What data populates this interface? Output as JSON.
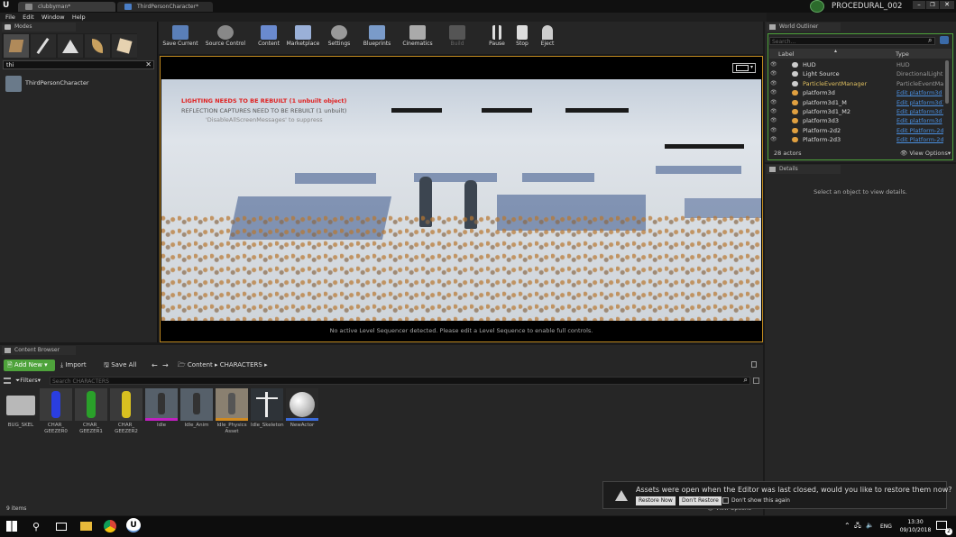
{
  "window": {
    "tabs": [
      "clubbyman*",
      "ThirdPersonCharacter*"
    ],
    "project": "PROCEDURAL_002"
  },
  "menu": [
    "File",
    "Edit",
    "Window",
    "Help"
  ],
  "modes": {
    "panel_title": "Modes",
    "search_value": "thi",
    "result": "ThirdPersonCharacter"
  },
  "toolbar": {
    "buttons": [
      "Save Current",
      "Source Control",
      "Content",
      "Marketplace",
      "Settings",
      "Blueprints",
      "Cinematics",
      "Build",
      "Pause",
      "Stop",
      "Eject"
    ]
  },
  "viewport": {
    "warning1": "LIGHTING NEEDS TO BE REBUILT (1 unbuilt object)",
    "warning2": "REFLECTION CAPTURES NEED TO BE REBUILT (1 unbuilt)",
    "warning3": "'DisableAllScreenMessages' to suppress",
    "footer": "No active Level Sequencer detected. Please edit a Level Sequence to enable full controls."
  },
  "outliner": {
    "title": "World Outliner",
    "search_placeholder": "Search...",
    "col_label": "Label",
    "col_type": "Type",
    "rows": [
      {
        "label": "HUD",
        "type": "HUD",
        "link": false
      },
      {
        "label": "Light Source",
        "type": "DirectionalLight",
        "link": false
      },
      {
        "label": "ParticleEventManager",
        "type": "ParticleEventMan",
        "link": false
      },
      {
        "label": "platform3d",
        "type": "Edit platform3d",
        "link": true
      },
      {
        "label": "platform3d1_M",
        "type": "Edit platform3d1_",
        "link": true
      },
      {
        "label": "platform3d1_M2",
        "type": "Edit platform3d1_",
        "link": true
      },
      {
        "label": "platform3d3",
        "type": "Edit platform3d",
        "link": true
      },
      {
        "label": "Platform-2d2",
        "type": "Edit Platform-2d",
        "link": true
      },
      {
        "label": "Platform-2d3",
        "type": "Edit Platform-2d",
        "link": true
      }
    ],
    "actor_count": "28 actors",
    "view_options": "View Options"
  },
  "details": {
    "title": "Details",
    "empty_text": "Select an object to view details."
  },
  "content_browser": {
    "title": "Content Browser",
    "add_new": "Add New",
    "import": "Import",
    "save_all": "Save All",
    "path": [
      "Content",
      "CHARACTERS"
    ],
    "filters": "Filters",
    "search_placeholder": "Search CHARACTERS",
    "assets": [
      {
        "name": "BUG_SKEL",
        "kind": "folder"
      },
      {
        "name": "CHAR_ GEEZER0",
        "kind": "blue"
      },
      {
        "name": "CHAR_ GEEZER1",
        "kind": "green"
      },
      {
        "name": "CHAR_ GEEZER2",
        "kind": "yellow"
      },
      {
        "name": "Idle",
        "kind": "anim"
      },
      {
        "name": "Idle_Anim",
        "kind": "anim"
      },
      {
        "name": "Idle_Physics Asset",
        "kind": "physics"
      },
      {
        "name": "Idle_Skeleton",
        "kind": "skeleton"
      },
      {
        "name": "NewActor",
        "kind": "sphere"
      }
    ],
    "item_count": "9 items",
    "view_options": "View Options"
  },
  "notification": {
    "message": "Assets were open when the Editor was last closed, would you like to restore them now?",
    "restore_now": "Restore Now",
    "dont_restore": "Don't Restore",
    "dont_show": "Don't show this again"
  },
  "taskbar": {
    "lang": "ENG",
    "time": "13:30",
    "date": "09/10/2018",
    "notif_count": "2"
  },
  "colors": {
    "accent_green": "#4ea33b",
    "link_blue": "#4a8fe0",
    "warning_red": "#e02020",
    "viewport_bg": "#c9d2dd"
  }
}
